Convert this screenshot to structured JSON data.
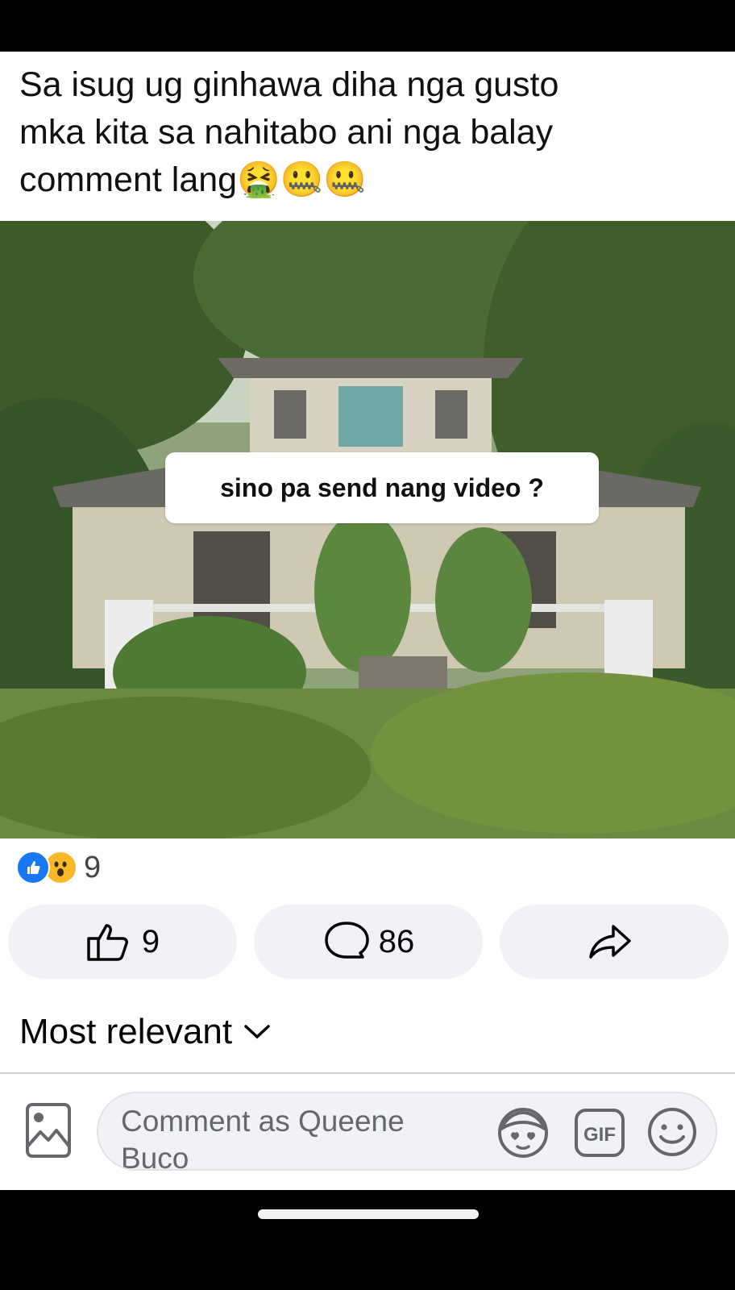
{
  "post": {
    "caption": "Sa isug ug ginhawa diha nga gusto\nmka kita sa nahitabo ani nga balay\ncomment lang🤮🤐🤐",
    "image_overlay_text": "sino pa send  nang video ?"
  },
  "reactions": {
    "count": "9",
    "types": [
      "like-icon",
      "wow-icon"
    ]
  },
  "actions": {
    "like_count": "9",
    "comment_count": "86",
    "share_label": ""
  },
  "comments": {
    "sort_label": "Most relevant",
    "input_placeholder": "Comment as Queene Buco"
  },
  "icons": {
    "like": "thumbs-up-icon",
    "comment": "comment-bubble-icon",
    "share": "share-arrow-icon",
    "attach_photo": "photo-icon",
    "avatar_sticker": "avatar-sticker-icon",
    "gif": "gif-icon",
    "emoji": "emoji-icon",
    "chevron": "chevron-down-icon"
  },
  "colors": {
    "accent": "#1877f2",
    "wow": "#f7b928",
    "button_bg": "#f0f2f5",
    "text_secondary": "#65676b"
  }
}
